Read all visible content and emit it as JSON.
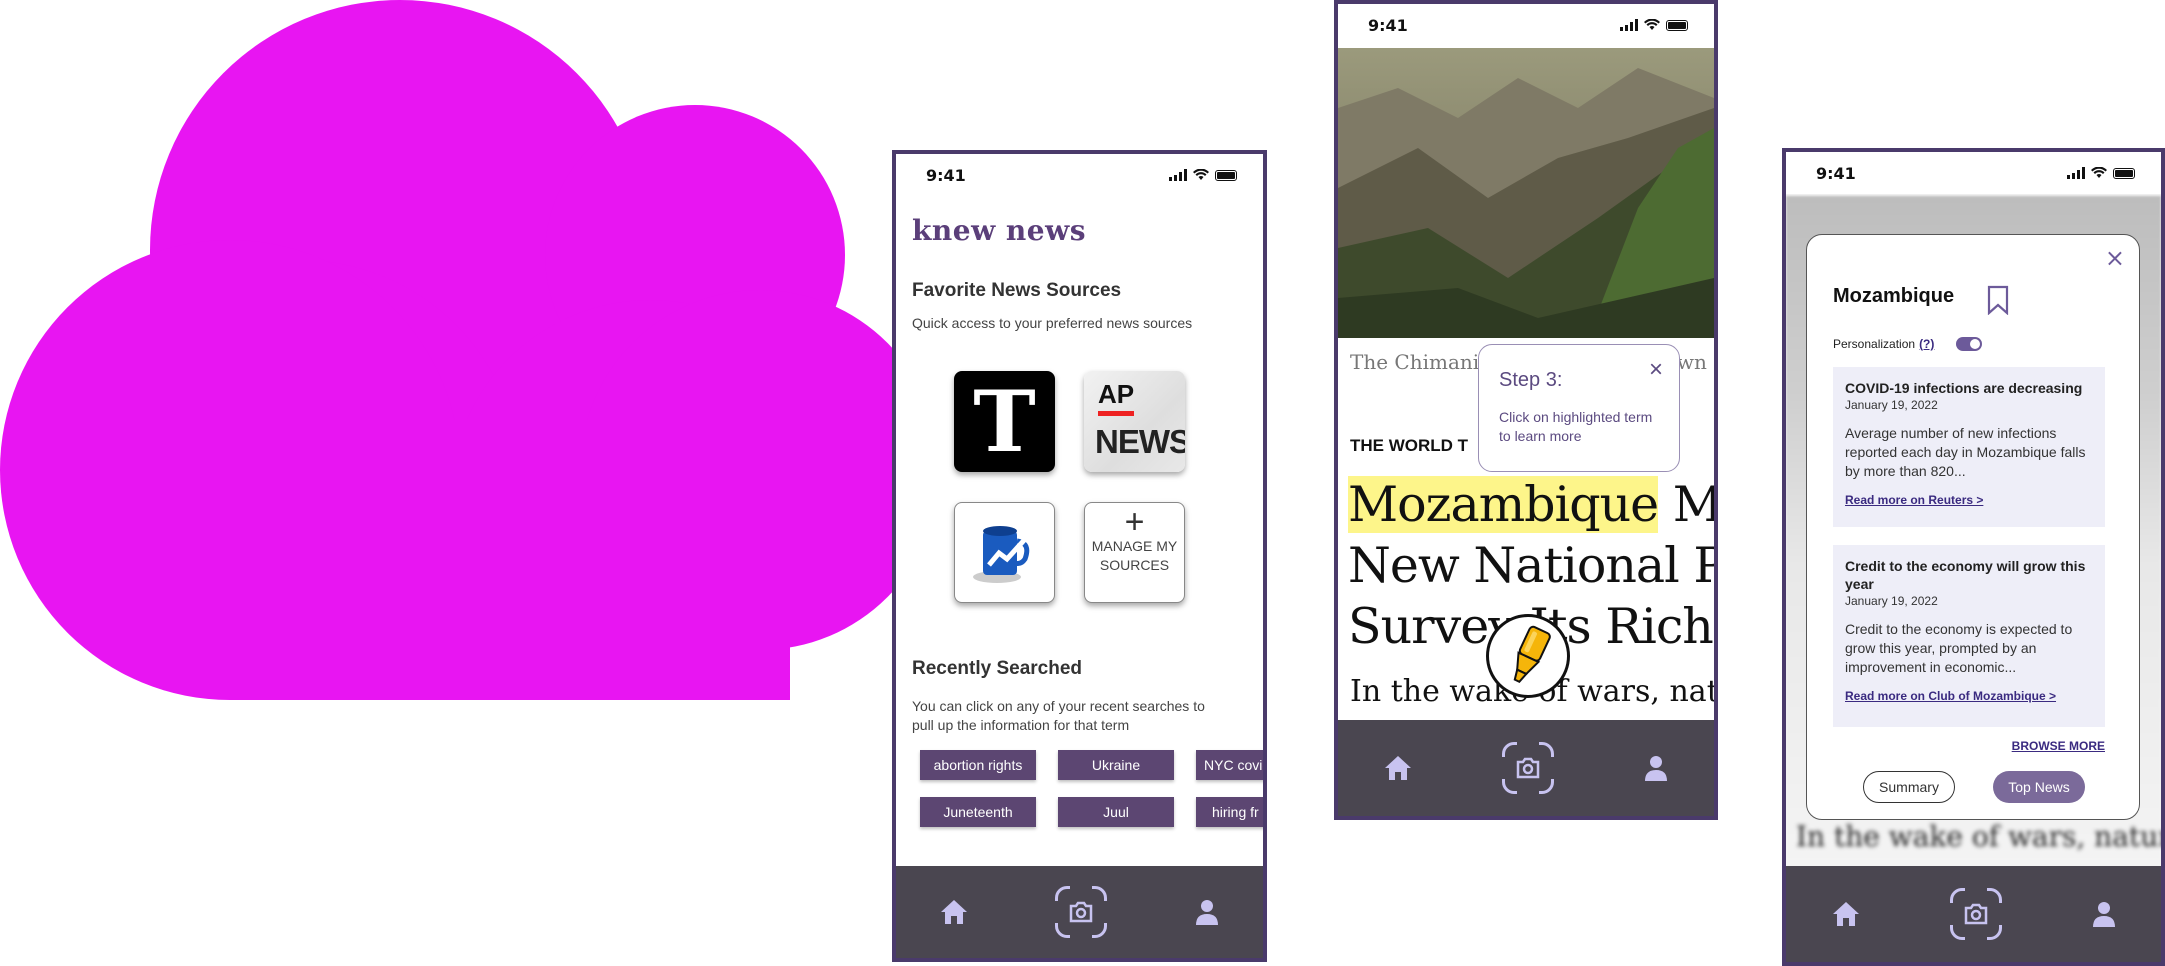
{
  "colors": {
    "cloud": "#e815f2",
    "frame": "#4a3a6b",
    "brand": "#5b3f7a",
    "tabbar": "#4a4650",
    "tab_icon": "#c8c3f0",
    "chip": "#5c4672",
    "highlight": "#fdf58a"
  },
  "phone1": {
    "status_time": "9:41",
    "app_name": "knew news",
    "favorites": {
      "title": "Favorite News Sources",
      "subtitle": "Quick access to your preferred news sources",
      "sources": [
        {
          "name": "New York Times",
          "glyph": "T"
        },
        {
          "name": "AP News",
          "line1": "AP",
          "line2": "NEWS"
        },
        {
          "name": "Wall Street Journal",
          "icon": "mug-chart-icon"
        }
      ],
      "manage_plus": "+",
      "manage_label": "MANAGE MY SOURCES"
    },
    "recent": {
      "title": "Recently Searched",
      "subtitle_line1": "You can click on any of your recent searches to",
      "subtitle_line2": "pull up the information for that term",
      "chips": [
        "abortion rights",
        "Ukraine",
        "NYC covid",
        "Juneteenth",
        "Juul",
        "hiring fr"
      ]
    },
    "tabs": [
      "home-icon",
      "camera-icon",
      "profile-icon"
    ]
  },
  "phone2": {
    "status_time": "9:41",
    "caption": "The Chimani",
    "caption_tail": "awn",
    "kicker": "THE WORLD T",
    "headline_highlight": "Mozambique",
    "headline_line1_rest": " Min",
    "headline_line2": "New National Par",
    "headline_line3": "Survey Its Riches",
    "body_text": "In the wake of wars, natural",
    "popup": {
      "title": "Step 3:",
      "text_line1": "Click on highlighted term",
      "text_line2": "to learn more",
      "close": "×"
    },
    "tabs": [
      "home-icon",
      "camera-icon",
      "profile-icon"
    ]
  },
  "phone3": {
    "status_time": "9:41",
    "card": {
      "title": "Mozambique",
      "close": "×",
      "personalization_label": "Personalization",
      "personalization_help": "(?)",
      "personalization_on": true,
      "news": [
        {
          "title": "COVID-19 infections are decreasing",
          "date": "January 19, 2022",
          "body": "Average number of new infections reported each day in Mozambique falls by more than 820...",
          "link": "Read more on Reuters >"
        },
        {
          "title": "Credit to the economy will grow this year",
          "date": "January 19, 2022",
          "body": "Credit to the economy is expected to grow this year, prompted by an improvement in economic...",
          "link": "Read more on Club of Mozambique >"
        }
      ],
      "browse_more": "BROWSE MORE",
      "summary_button": "Summary",
      "top_news_button": "Top News"
    },
    "background_text": "In the wake of wars, natural",
    "tabs": [
      "home-icon",
      "camera-icon",
      "profile-icon"
    ]
  }
}
